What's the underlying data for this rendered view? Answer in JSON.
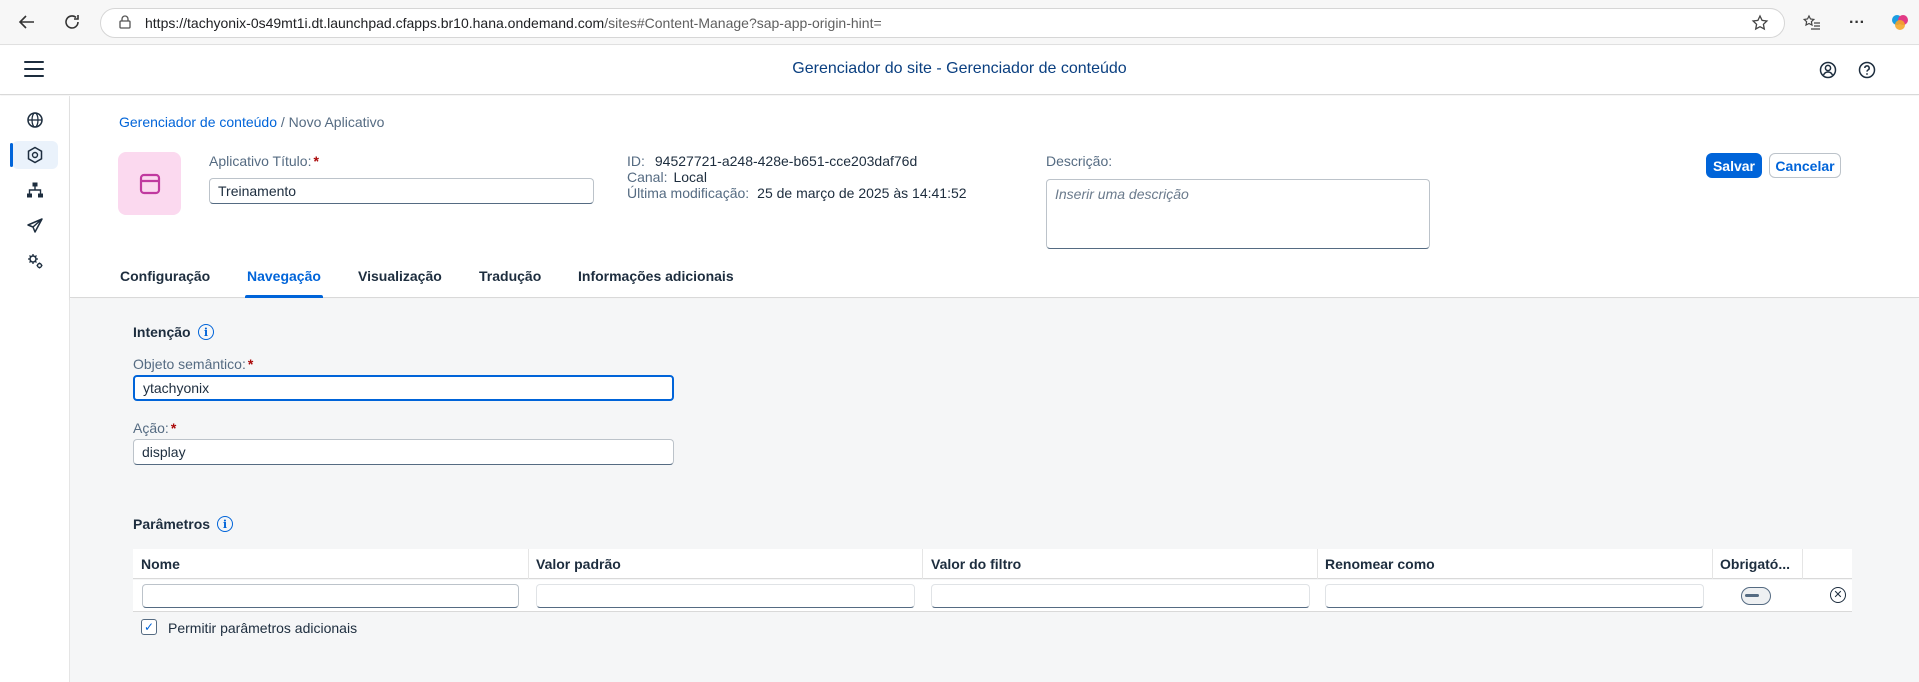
{
  "browser": {
    "url_host": "https://tachyonix-0s49mt1i.dt.launchpad.cfapps.br10.hana.ondemand.com",
    "url_path": "/sites#Content-Manage?sap-app-origin-hint="
  },
  "shell": {
    "title": "Gerenciador do site - Gerenciador de conteúdo"
  },
  "breadcrumb": {
    "link": "Gerenciador de conteúdo",
    "current": "/ Novo Aplicativo"
  },
  "header": {
    "title_label": "Aplicativo Título:",
    "title_value": "Treinamento",
    "id_label": "ID:",
    "id_value": "94527721-a248-428e-b651-cce203daf76d",
    "channel_label": "Canal:",
    "channel_value": "Local",
    "modified_label": "Última modificação:",
    "modified_value": "25 de março de 2025 às 14:41:52",
    "description_label": "Descrição:",
    "description_placeholder": "Inserir uma descrição",
    "save_label": "Salvar",
    "cancel_label": "Cancelar",
    "required_mark": "*"
  },
  "tabs": [
    {
      "label": "Configuração",
      "active": false
    },
    {
      "label": "Navegação",
      "active": true
    },
    {
      "label": "Visualização",
      "active": false
    },
    {
      "label": "Tradução",
      "active": false
    },
    {
      "label": "Informações adicionais",
      "active": false
    }
  ],
  "intent": {
    "section_title": "Intenção",
    "semantic_object_label": "Objeto semântico:",
    "semantic_object_value": "ytachyonix",
    "action_label": "Ação:",
    "action_value": "display"
  },
  "parameters": {
    "section_title": "Parâmetros",
    "columns": [
      "Nome",
      "Valor padrão",
      "Valor do filtro",
      "Renomear como",
      "Obrigató..."
    ],
    "allow_additional_label": "Permitir parâmetros adicionais",
    "allow_additional_checked": true
  },
  "colors": {
    "accent": "#0064d9",
    "shell_title": "#0a3f80",
    "avatar_bg": "#fbd9ef",
    "avatar_icon": "#c0399f",
    "required": "#aa0808"
  }
}
